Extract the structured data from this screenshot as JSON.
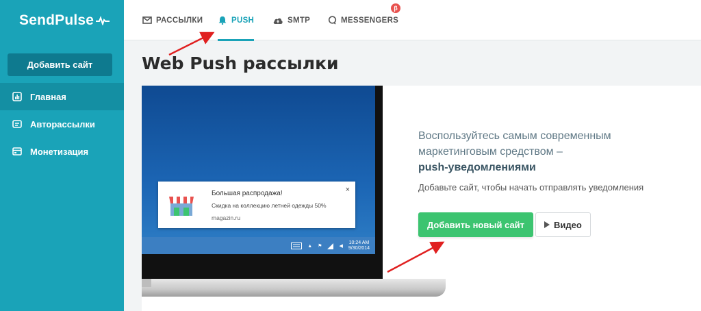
{
  "app": {
    "logo_text": "SendPulse"
  },
  "sidebar": {
    "add_site_label": "Добавить сайт",
    "items": [
      {
        "label": "Главная",
        "icon": "dashboard-icon"
      },
      {
        "label": "Авторассылки",
        "icon": "automation-icon"
      },
      {
        "label": "Монетизация",
        "icon": "monetization-icon"
      }
    ]
  },
  "tabs": [
    {
      "label": "РАССЫЛКИ",
      "icon": "envelope-icon"
    },
    {
      "label": "PUSH",
      "icon": "bell-icon",
      "active": true
    },
    {
      "label": "SMTP",
      "icon": "cloud-icon"
    },
    {
      "label": "MESSENGERS",
      "icon": "chat-icon"
    }
  ],
  "beta_badge": "β",
  "page": {
    "title": "Web Push рассылки"
  },
  "illustration": {
    "notification": {
      "title": "Большая распродажа!",
      "body": "Скидка на коллекцию летней одежды 50%",
      "domain": "magazin.ru",
      "close": "×"
    },
    "clock_time": "10:24 AM",
    "clock_date": "9/30/2014"
  },
  "promo": {
    "line1": "Воспользуйтесь самым современным",
    "line2": "маркетинговым средством –",
    "strong": "push-уведомлениями",
    "subtitle": "Добавьте сайт, чтобы начать отправлять уведомления",
    "primary_button": "Добавить новый сайт",
    "video_button": "Видео"
  },
  "colors": {
    "accent": "#1aa3b8",
    "sidebar": "#1aa3b8",
    "primary": "#3cc470",
    "badge": "#e8524f",
    "arrow": "#e02020"
  }
}
